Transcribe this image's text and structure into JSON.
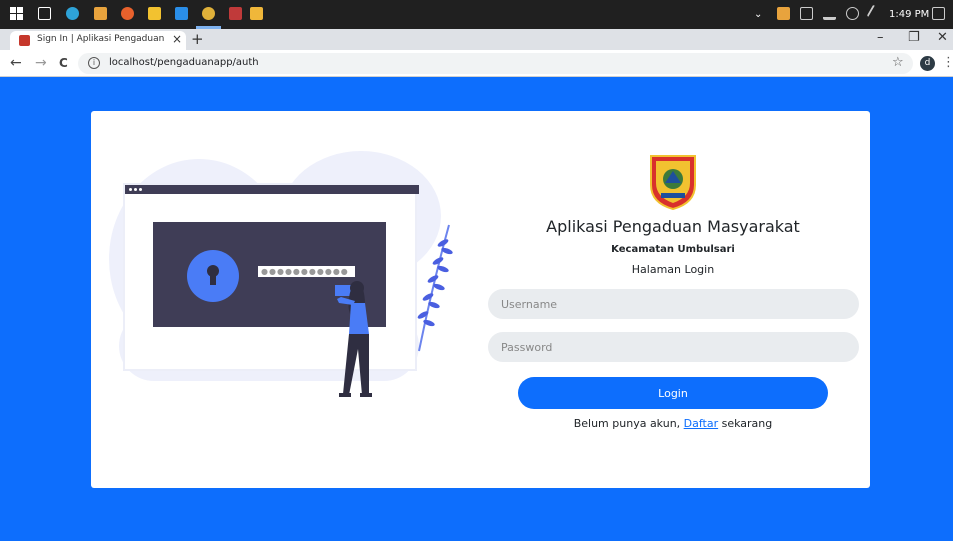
{
  "taskbar": {
    "icons": [
      "windows-start-icon",
      "task-view-icon",
      "edge-icon",
      "app-icon",
      "firefox-icon",
      "files-icon",
      "vscode-icon",
      "chrome-icon",
      "app-icon",
      "explorer-icon"
    ],
    "clock": "1:49 PM",
    "colors": {
      "bg": "#202020",
      "active": "#7fb3f0"
    }
  },
  "browser": {
    "tab_title": "Sign In | Aplikasi Pengaduan Masyarakat",
    "url": "localhost/pengaduanapp/auth",
    "profile_initial": "d",
    "icons": {
      "close": "×",
      "new_tab": "+",
      "minimize": "–",
      "restore": "❐",
      "window_close": "✕",
      "back": "←",
      "forward": "→",
      "reload": "C",
      "info": "i",
      "star": "☆",
      "menu": "⋮",
      "tray_chevron": "⌄"
    }
  },
  "illustration": {
    "password_mask": "●●●●●●●●●●●"
  },
  "login": {
    "title": "Aplikasi Pengaduan Masyarakat",
    "subtitle": "Kecamatan Umbulsari",
    "caption": "Halaman Login",
    "username_placeholder": "Username",
    "password_placeholder": "Password",
    "button_label": "Login",
    "register_prefix": "Belum punya akun, ",
    "register_link": "Daftar",
    "register_suffix": " sekarang"
  },
  "colors": {
    "primary": "#0d6efd",
    "input_bg": "#e9ecef",
    "illustration_dark": "#3f3d56",
    "illustration_accent": "#4a7cf6"
  }
}
